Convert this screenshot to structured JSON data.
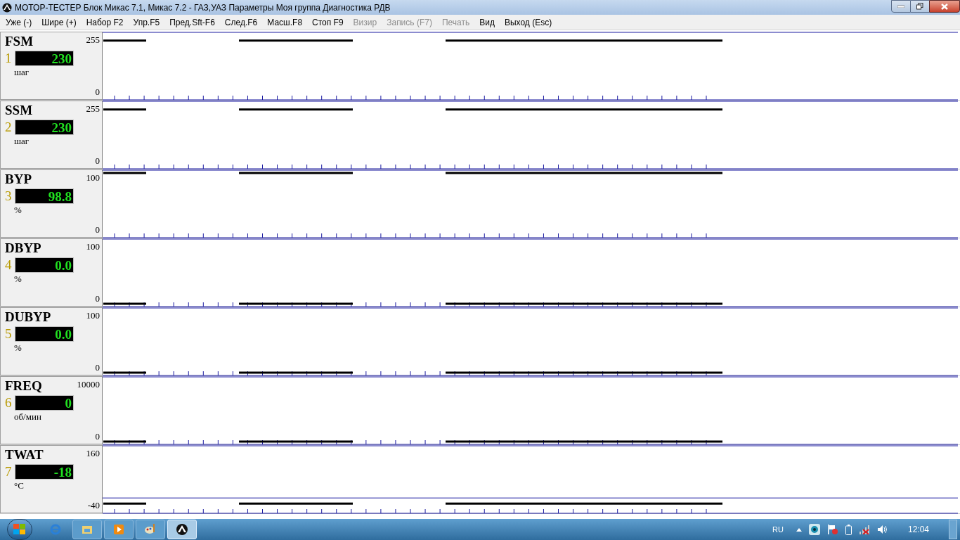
{
  "window": {
    "title": "МОТОР-ТЕСТЕР Блок Микас 7.1, Микас 7.2 - ГАЗ,УАЗ Параметры Моя группа Диагностика РДВ"
  },
  "menu": [
    {
      "label": "Уже (-)",
      "disabled": false
    },
    {
      "label": "Шире (+)",
      "disabled": false
    },
    {
      "label": "Набор F2",
      "disabled": false
    },
    {
      "label": "Упр.F5",
      "disabled": false
    },
    {
      "label": "Пред.Sft-F6",
      "disabled": false
    },
    {
      "label": "След.F6",
      "disabled": false
    },
    {
      "label": "Масш.F8",
      "disabled": false
    },
    {
      "label": "Стоп F9",
      "disabled": false
    },
    {
      "label": "Визир",
      "disabled": true
    },
    {
      "label": "Запись (F7)",
      "disabled": true
    },
    {
      "label": "Печать",
      "disabled": true
    },
    {
      "label": "Вид",
      "disabled": false
    },
    {
      "label": "Выход (Esc)",
      "disabled": false
    }
  ],
  "channels": [
    {
      "name": "FSM",
      "number": "1",
      "value": "230",
      "unit": "шаг",
      "max": "255",
      "min": "0"
    },
    {
      "name": "SSM",
      "number": "2",
      "value": "230",
      "unit": "шаг",
      "max": "255",
      "min": "0"
    },
    {
      "name": "BYP",
      "number": "3",
      "value": "98.8",
      "unit": "%",
      "max": "100",
      "min": "0"
    },
    {
      "name": "DBYP",
      "number": "4",
      "value": "0.0",
      "unit": "%",
      "max": "100",
      "min": "0"
    },
    {
      "name": "DUBYP",
      "number": "5",
      "value": "0.0",
      "unit": "%",
      "max": "100",
      "min": "0"
    },
    {
      "name": "FREQ",
      "number": "6",
      "value": "0",
      "unit": "об/мин",
      "max": "10000",
      "min": "0"
    },
    {
      "name": "TWAT",
      "number": "7",
      "value": "-18",
      "unit": "°C",
      "max": "160",
      "min": "-40"
    }
  ],
  "taskbar": {
    "apps": [
      {
        "selected": false
      },
      {
        "selected": false
      },
      {
        "selected": false
      },
      {
        "selected": false
      },
      {
        "selected": true
      }
    ]
  },
  "tray": {
    "language": "RU",
    "clock": "12:04"
  }
}
